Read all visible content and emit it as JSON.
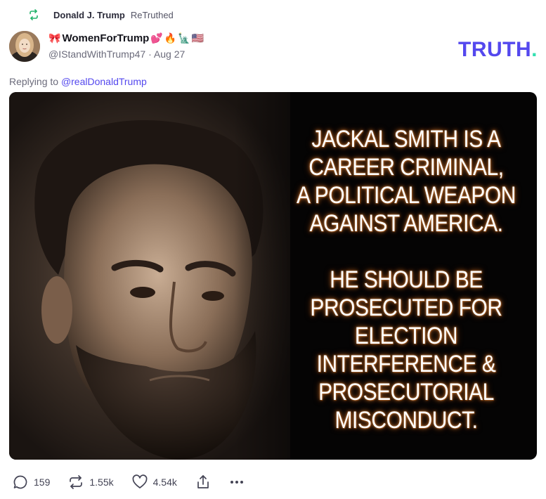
{
  "retruth": {
    "icon": "retruth-icon",
    "name": "Donald J. Trump",
    "suffix": "ReTruthed",
    "color": "#22b36b"
  },
  "author": {
    "avatar_icon": "avatar",
    "display_name": "WomenForTrump",
    "name_emojis": [
      "🎀",
      "💕",
      "🔥",
      "🗽",
      "🇺🇸"
    ],
    "handle": "@IStandWithTrump47",
    "separator": "·",
    "date": "Aug 27"
  },
  "brand": {
    "logo_text": "TRUTH",
    "logo_dot": ".",
    "primary_color": "#5448ee",
    "accent_color": "#33e0b0"
  },
  "reply": {
    "prefix": "Replying to",
    "mention": "@realDonaldTrump"
  },
  "media": {
    "text_block_1": [
      "JACKAL SMITH IS A",
      "CAREER CRIMINAL,",
      "A POLITICAL WEAPON",
      "AGAINST AMERICA."
    ],
    "text_block_2": [
      "HE SHOULD BE",
      "PROSECUTED FOR",
      "ELECTION",
      "INTERFERENCE &",
      "PROSECUTORIAL",
      "MISCONDUCT."
    ]
  },
  "actions": {
    "reply": {
      "icon": "reply-bubble-icon",
      "count": "159"
    },
    "retruth": {
      "icon": "retruth-icon",
      "count": "1.55k"
    },
    "like": {
      "icon": "heart-icon",
      "count": "4.54k"
    },
    "share": {
      "icon": "share-icon"
    },
    "more": {
      "icon": "more-dots-icon"
    }
  }
}
